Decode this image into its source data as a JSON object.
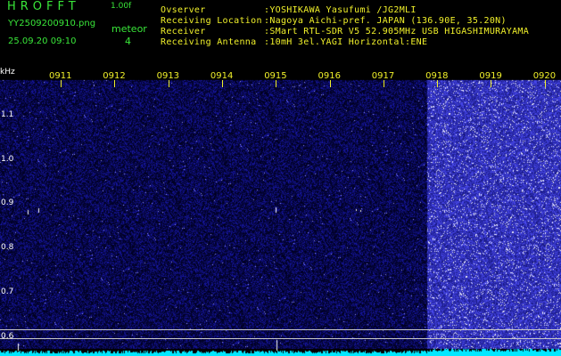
{
  "header": {
    "app_title": "HROFFT",
    "app_version": "1.00f",
    "file_name": "YY2509200910.png",
    "timestamp": "25.09.20 09:10",
    "meteor_label": "meteor",
    "meteor_count": "4",
    "info": [
      {
        "label": "Ovserver",
        "value": ":YOSHIKAWA Yasufumi /JG2MLI"
      },
      {
        "label": "Receiving Location",
        "value": ":Nagoya Aichi-pref. JAPAN (136.90E, 35.20N)"
      },
      {
        "label": "Receiver",
        "value": ":SMart RTL-SDR V5 52.905MHz USB HIGASHIMURAYAMA"
      },
      {
        "label": "Receiving Antenna",
        "value": ":10mH 3el.YAGI Horizontal:ENE"
      }
    ]
  },
  "spectrogram": {
    "unit": "kHz",
    "freq_ticks": [
      "1.1",
      "1.0",
      "0.9",
      "0.8",
      "0.7",
      "0.6"
    ],
    "time_ticks": [
      "0911",
      "0912",
      "0913",
      "0914",
      "0915",
      "0916",
      "0917",
      "0918",
      "0919",
      "0920"
    ],
    "colors": {
      "background": "#000000",
      "noise": "#2a2ad8",
      "signal": "#ffffff",
      "baseline": "#00ffff",
      "labels": "#f0f02a"
    }
  }
}
